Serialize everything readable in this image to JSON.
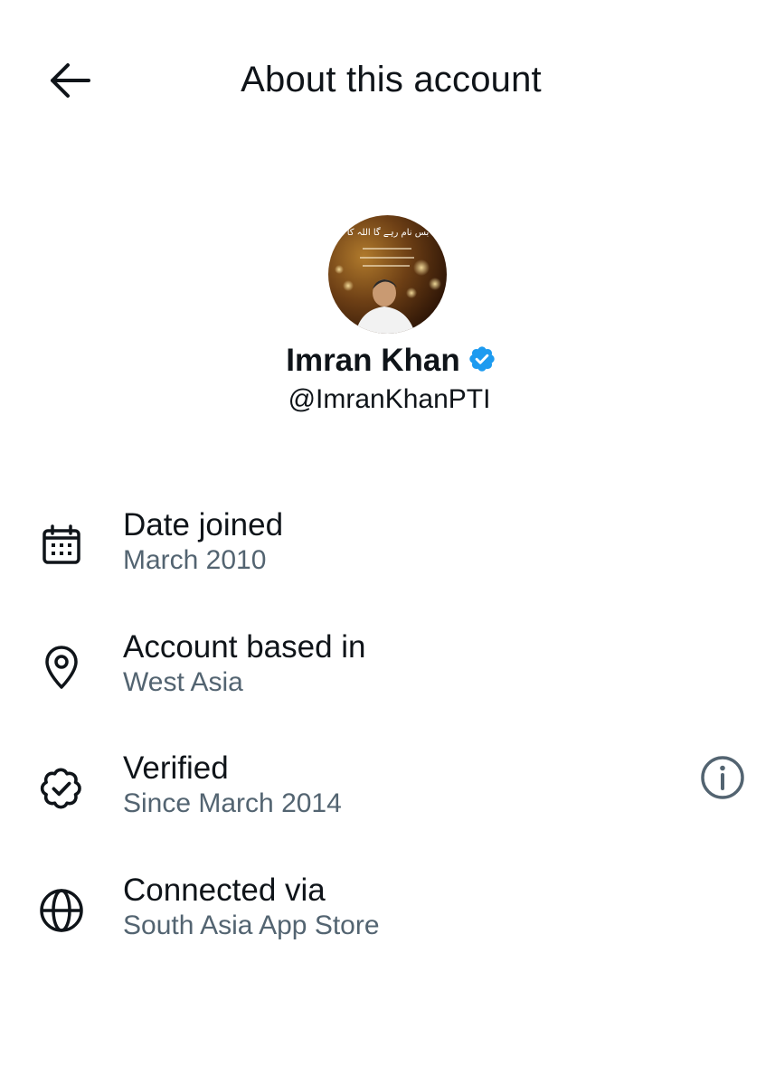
{
  "header": {
    "back_icon": "arrow-left-icon",
    "title": "About this account"
  },
  "profile": {
    "avatar_text_line1": "بس نام رہے گا اللہ کا",
    "display_name": "Imran Khan",
    "verified_badge_icon": "verified-badge-icon",
    "verified_color": "#1d9bf0",
    "handle": "@ImranKhanPTI"
  },
  "info": {
    "date_joined": {
      "icon": "calendar-icon",
      "label": "Date joined",
      "value": "March 2010"
    },
    "location": {
      "icon": "location-pin-icon",
      "label": "Account based in",
      "value": "West Asia"
    },
    "verified": {
      "icon": "verified-seal-icon",
      "label": "Verified",
      "value": "Since March 2014",
      "action_icon": "info-icon"
    },
    "connected": {
      "icon": "globe-icon",
      "label": "Connected via",
      "value": "South Asia App Store"
    }
  },
  "colors": {
    "primary_text": "#0f1419",
    "secondary_text": "#536471",
    "background": "#ffffff"
  }
}
